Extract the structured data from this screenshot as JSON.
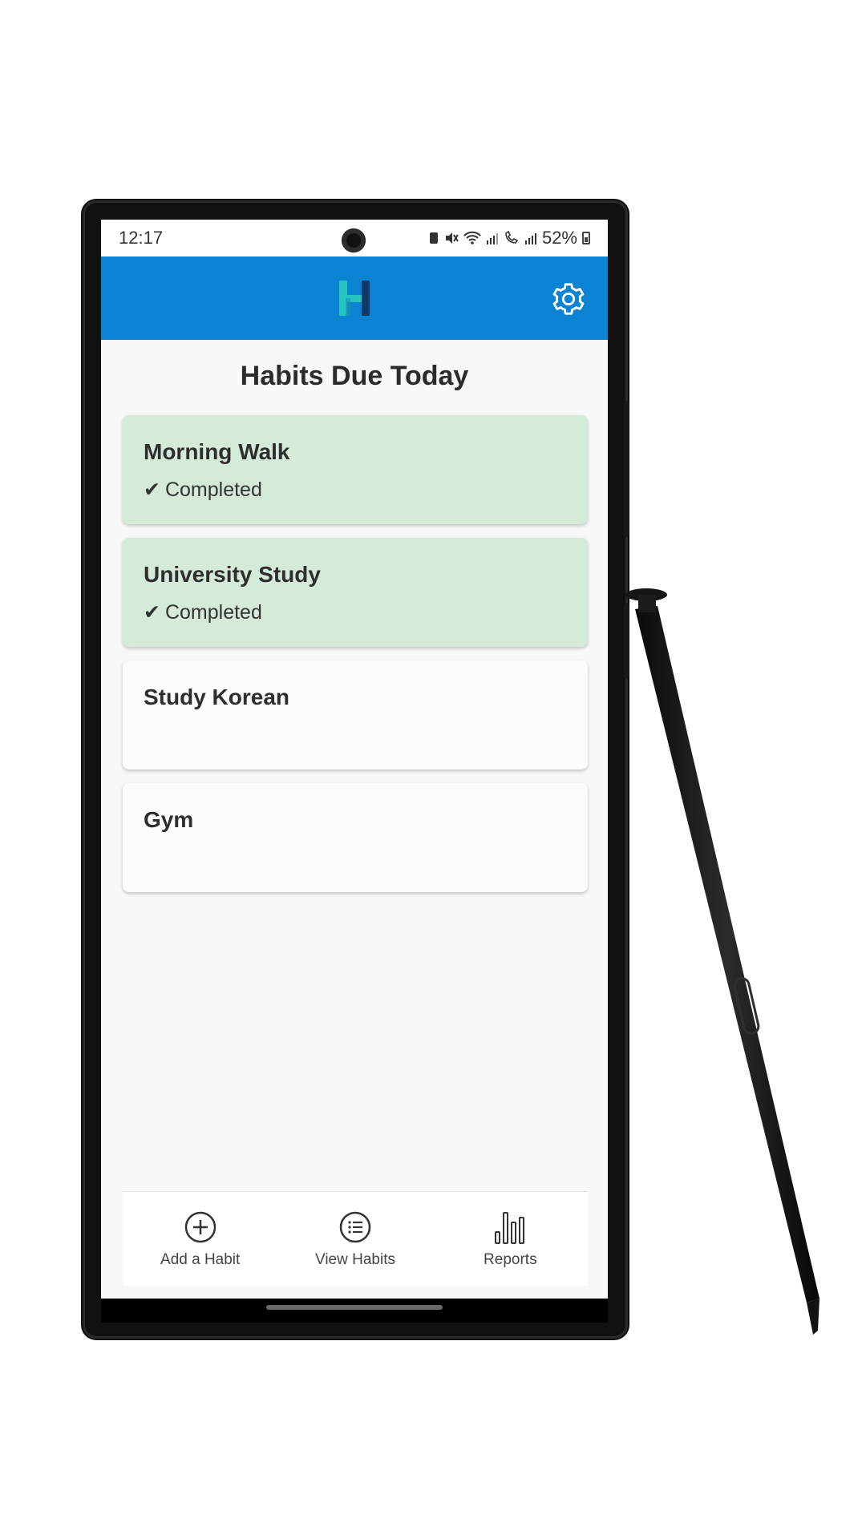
{
  "status_bar": {
    "time": "12:17",
    "battery": "52%"
  },
  "app_bar": {
    "logo_icon": "habit-h-logo-icon",
    "settings_icon": "gear-icon",
    "colors": {
      "bar": "#0a84d2",
      "logo_teal": "#27c3c0",
      "logo_dark": "#0d3b66"
    }
  },
  "page": {
    "title": "Habits Due Today"
  },
  "habits": [
    {
      "name": "Morning Walk",
      "status": "Completed",
      "check": "✔",
      "completed": true
    },
    {
      "name": "University Study",
      "status": "Completed",
      "check": "✔",
      "completed": true
    },
    {
      "name": "Study Korean",
      "status": "",
      "check": "",
      "completed": false
    },
    {
      "name": "Gym",
      "status": "",
      "check": "",
      "completed": false
    }
  ],
  "bottom_nav": {
    "items": [
      {
        "label": "Add a Habit",
        "icon": "plus-circle-icon"
      },
      {
        "label": "View Habits",
        "icon": "list-circle-icon"
      },
      {
        "label": "Reports",
        "icon": "bar-chart-icon"
      }
    ]
  },
  "colors": {
    "completed_card": "#d4ebd9",
    "pending_card": "#fcfcfc"
  }
}
